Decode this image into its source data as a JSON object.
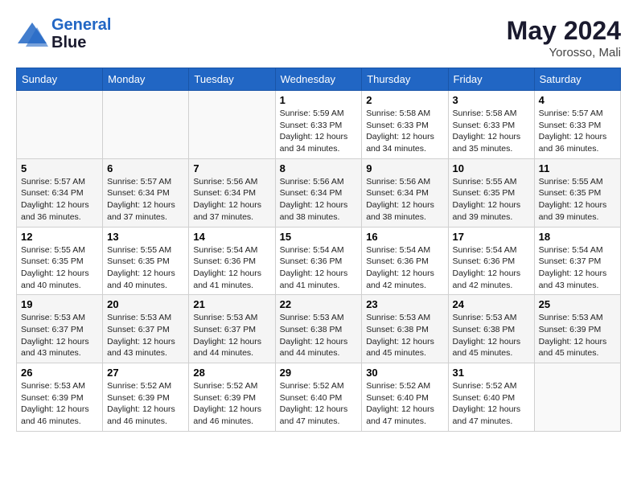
{
  "header": {
    "logo_line1": "General",
    "logo_line2": "Blue",
    "month": "May 2024",
    "location": "Yorosso, Mali"
  },
  "weekdays": [
    "Sunday",
    "Monday",
    "Tuesday",
    "Wednesday",
    "Thursday",
    "Friday",
    "Saturday"
  ],
  "weeks": [
    [
      {
        "day": "",
        "info": ""
      },
      {
        "day": "",
        "info": ""
      },
      {
        "day": "",
        "info": ""
      },
      {
        "day": "1",
        "info": "Sunrise: 5:59 AM\nSunset: 6:33 PM\nDaylight: 12 hours\nand 34 minutes."
      },
      {
        "day": "2",
        "info": "Sunrise: 5:58 AM\nSunset: 6:33 PM\nDaylight: 12 hours\nand 34 minutes."
      },
      {
        "day": "3",
        "info": "Sunrise: 5:58 AM\nSunset: 6:33 PM\nDaylight: 12 hours\nand 35 minutes."
      },
      {
        "day": "4",
        "info": "Sunrise: 5:57 AM\nSunset: 6:33 PM\nDaylight: 12 hours\nand 36 minutes."
      }
    ],
    [
      {
        "day": "5",
        "info": "Sunrise: 5:57 AM\nSunset: 6:34 PM\nDaylight: 12 hours\nand 36 minutes."
      },
      {
        "day": "6",
        "info": "Sunrise: 5:57 AM\nSunset: 6:34 PM\nDaylight: 12 hours\nand 37 minutes."
      },
      {
        "day": "7",
        "info": "Sunrise: 5:56 AM\nSunset: 6:34 PM\nDaylight: 12 hours\nand 37 minutes."
      },
      {
        "day": "8",
        "info": "Sunrise: 5:56 AM\nSunset: 6:34 PM\nDaylight: 12 hours\nand 38 minutes."
      },
      {
        "day": "9",
        "info": "Sunrise: 5:56 AM\nSunset: 6:34 PM\nDaylight: 12 hours\nand 38 minutes."
      },
      {
        "day": "10",
        "info": "Sunrise: 5:55 AM\nSunset: 6:35 PM\nDaylight: 12 hours\nand 39 minutes."
      },
      {
        "day": "11",
        "info": "Sunrise: 5:55 AM\nSunset: 6:35 PM\nDaylight: 12 hours\nand 39 minutes."
      }
    ],
    [
      {
        "day": "12",
        "info": "Sunrise: 5:55 AM\nSunset: 6:35 PM\nDaylight: 12 hours\nand 40 minutes."
      },
      {
        "day": "13",
        "info": "Sunrise: 5:55 AM\nSunset: 6:35 PM\nDaylight: 12 hours\nand 40 minutes."
      },
      {
        "day": "14",
        "info": "Sunrise: 5:54 AM\nSunset: 6:36 PM\nDaylight: 12 hours\nand 41 minutes."
      },
      {
        "day": "15",
        "info": "Sunrise: 5:54 AM\nSunset: 6:36 PM\nDaylight: 12 hours\nand 41 minutes."
      },
      {
        "day": "16",
        "info": "Sunrise: 5:54 AM\nSunset: 6:36 PM\nDaylight: 12 hours\nand 42 minutes."
      },
      {
        "day": "17",
        "info": "Sunrise: 5:54 AM\nSunset: 6:36 PM\nDaylight: 12 hours\nand 42 minutes."
      },
      {
        "day": "18",
        "info": "Sunrise: 5:54 AM\nSunset: 6:37 PM\nDaylight: 12 hours\nand 43 minutes."
      }
    ],
    [
      {
        "day": "19",
        "info": "Sunrise: 5:53 AM\nSunset: 6:37 PM\nDaylight: 12 hours\nand 43 minutes."
      },
      {
        "day": "20",
        "info": "Sunrise: 5:53 AM\nSunset: 6:37 PM\nDaylight: 12 hours\nand 43 minutes."
      },
      {
        "day": "21",
        "info": "Sunrise: 5:53 AM\nSunset: 6:37 PM\nDaylight: 12 hours\nand 44 minutes."
      },
      {
        "day": "22",
        "info": "Sunrise: 5:53 AM\nSunset: 6:38 PM\nDaylight: 12 hours\nand 44 minutes."
      },
      {
        "day": "23",
        "info": "Sunrise: 5:53 AM\nSunset: 6:38 PM\nDaylight: 12 hours\nand 45 minutes."
      },
      {
        "day": "24",
        "info": "Sunrise: 5:53 AM\nSunset: 6:38 PM\nDaylight: 12 hours\nand 45 minutes."
      },
      {
        "day": "25",
        "info": "Sunrise: 5:53 AM\nSunset: 6:39 PM\nDaylight: 12 hours\nand 45 minutes."
      }
    ],
    [
      {
        "day": "26",
        "info": "Sunrise: 5:53 AM\nSunset: 6:39 PM\nDaylight: 12 hours\nand 46 minutes."
      },
      {
        "day": "27",
        "info": "Sunrise: 5:52 AM\nSunset: 6:39 PM\nDaylight: 12 hours\nand 46 minutes."
      },
      {
        "day": "28",
        "info": "Sunrise: 5:52 AM\nSunset: 6:39 PM\nDaylight: 12 hours\nand 46 minutes."
      },
      {
        "day": "29",
        "info": "Sunrise: 5:52 AM\nSunset: 6:40 PM\nDaylight: 12 hours\nand 47 minutes."
      },
      {
        "day": "30",
        "info": "Sunrise: 5:52 AM\nSunset: 6:40 PM\nDaylight: 12 hours\nand 47 minutes."
      },
      {
        "day": "31",
        "info": "Sunrise: 5:52 AM\nSunset: 6:40 PM\nDaylight: 12 hours\nand 47 minutes."
      },
      {
        "day": "",
        "info": ""
      }
    ]
  ]
}
